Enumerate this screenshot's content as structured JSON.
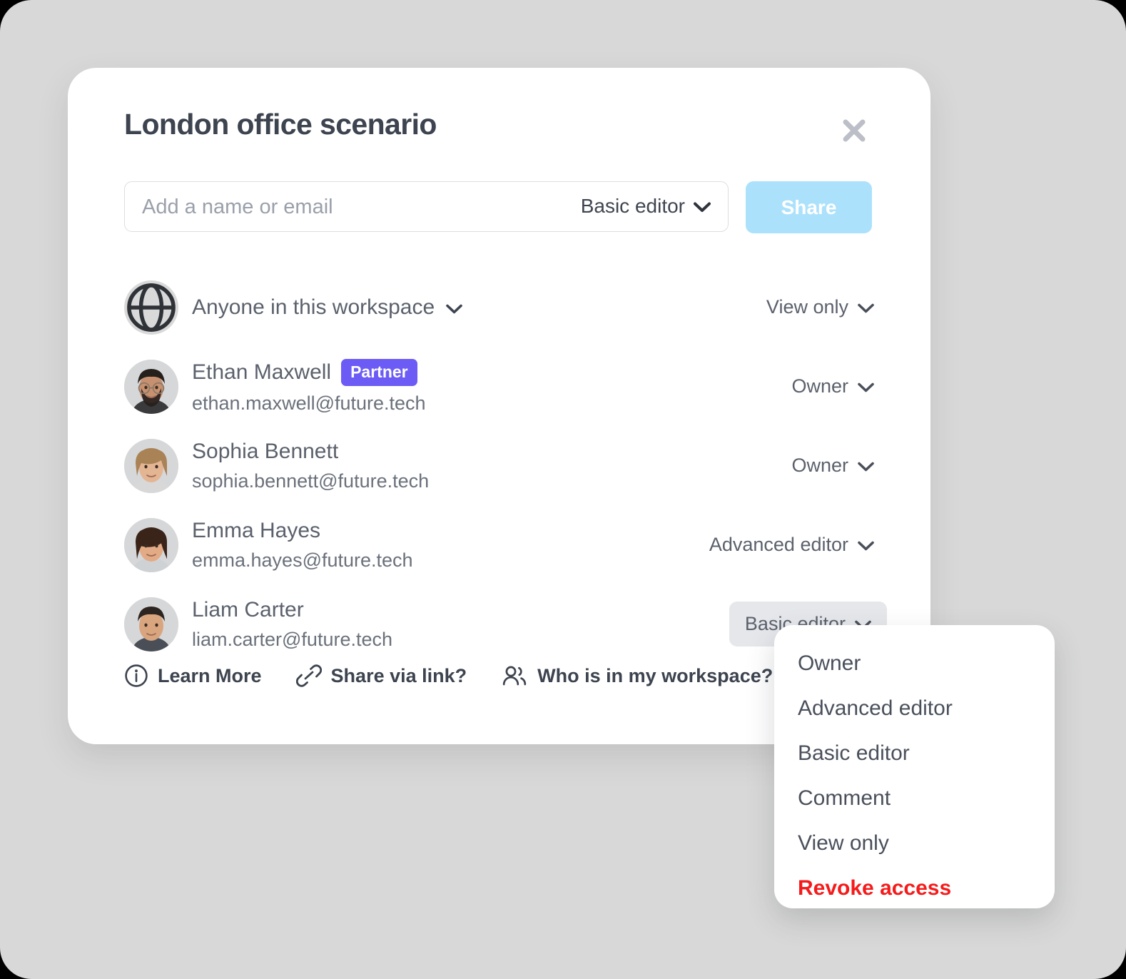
{
  "card": {
    "title": "London office scenario",
    "close_icon": "close-icon"
  },
  "invite": {
    "placeholder": "Add a name or email",
    "value": "",
    "role_label": "Basic editor",
    "share_label": "Share"
  },
  "access_rows": [
    {
      "type": "workspace",
      "icon": "globe-icon",
      "label": "Anyone in this workspace",
      "role": "View only",
      "role_active": false
    },
    {
      "type": "person",
      "avatar": "avatar-ethan-maxwell",
      "name": "Ethan Maxwell",
      "badge": "Partner",
      "email": "ethan.maxwell@future.tech",
      "role": "Owner",
      "role_active": false
    },
    {
      "type": "person",
      "avatar": "avatar-sophia-bennett",
      "name": "Sophia Bennett",
      "badge": "",
      "email": "sophia.bennett@future.tech",
      "role": "Owner",
      "role_active": false
    },
    {
      "type": "person",
      "avatar": "avatar-emma-hayes",
      "name": "Emma Hayes",
      "badge": "",
      "email": "emma.hayes@future.tech",
      "role": "Advanced editor",
      "role_active": false
    },
    {
      "type": "person",
      "avatar": "avatar-liam-carter",
      "name": "Liam Carter",
      "badge": "",
      "email": "liam.carter@future.tech",
      "role": "Basic editor",
      "role_active": true
    }
  ],
  "footer": {
    "links": [
      {
        "icon": "info-circle-icon",
        "label": "Learn More"
      },
      {
        "icon": "link-icon",
        "label": "Share via link?"
      },
      {
        "icon": "people-icon",
        "label": "Who is in my workspace?"
      }
    ]
  },
  "role_menu": {
    "items": [
      {
        "label": "Owner",
        "danger": false
      },
      {
        "label": "Advanced editor",
        "danger": false
      },
      {
        "label": "Basic editor",
        "danger": false
      },
      {
        "label": "Comment",
        "danger": false
      },
      {
        "label": "View only",
        "danger": false
      },
      {
        "label": "Revoke access",
        "danger": true
      }
    ]
  },
  "colors": {
    "page_background": "#d8d8d8",
    "card_background": "#ffffff",
    "title_text": "#3d444f",
    "share_button": "#ace1fc",
    "badge_partner": "#6c5cf5",
    "active_role_pill": "#e5e7eb",
    "danger_text": "#f51b1b",
    "muted_text": "#5b616c"
  }
}
